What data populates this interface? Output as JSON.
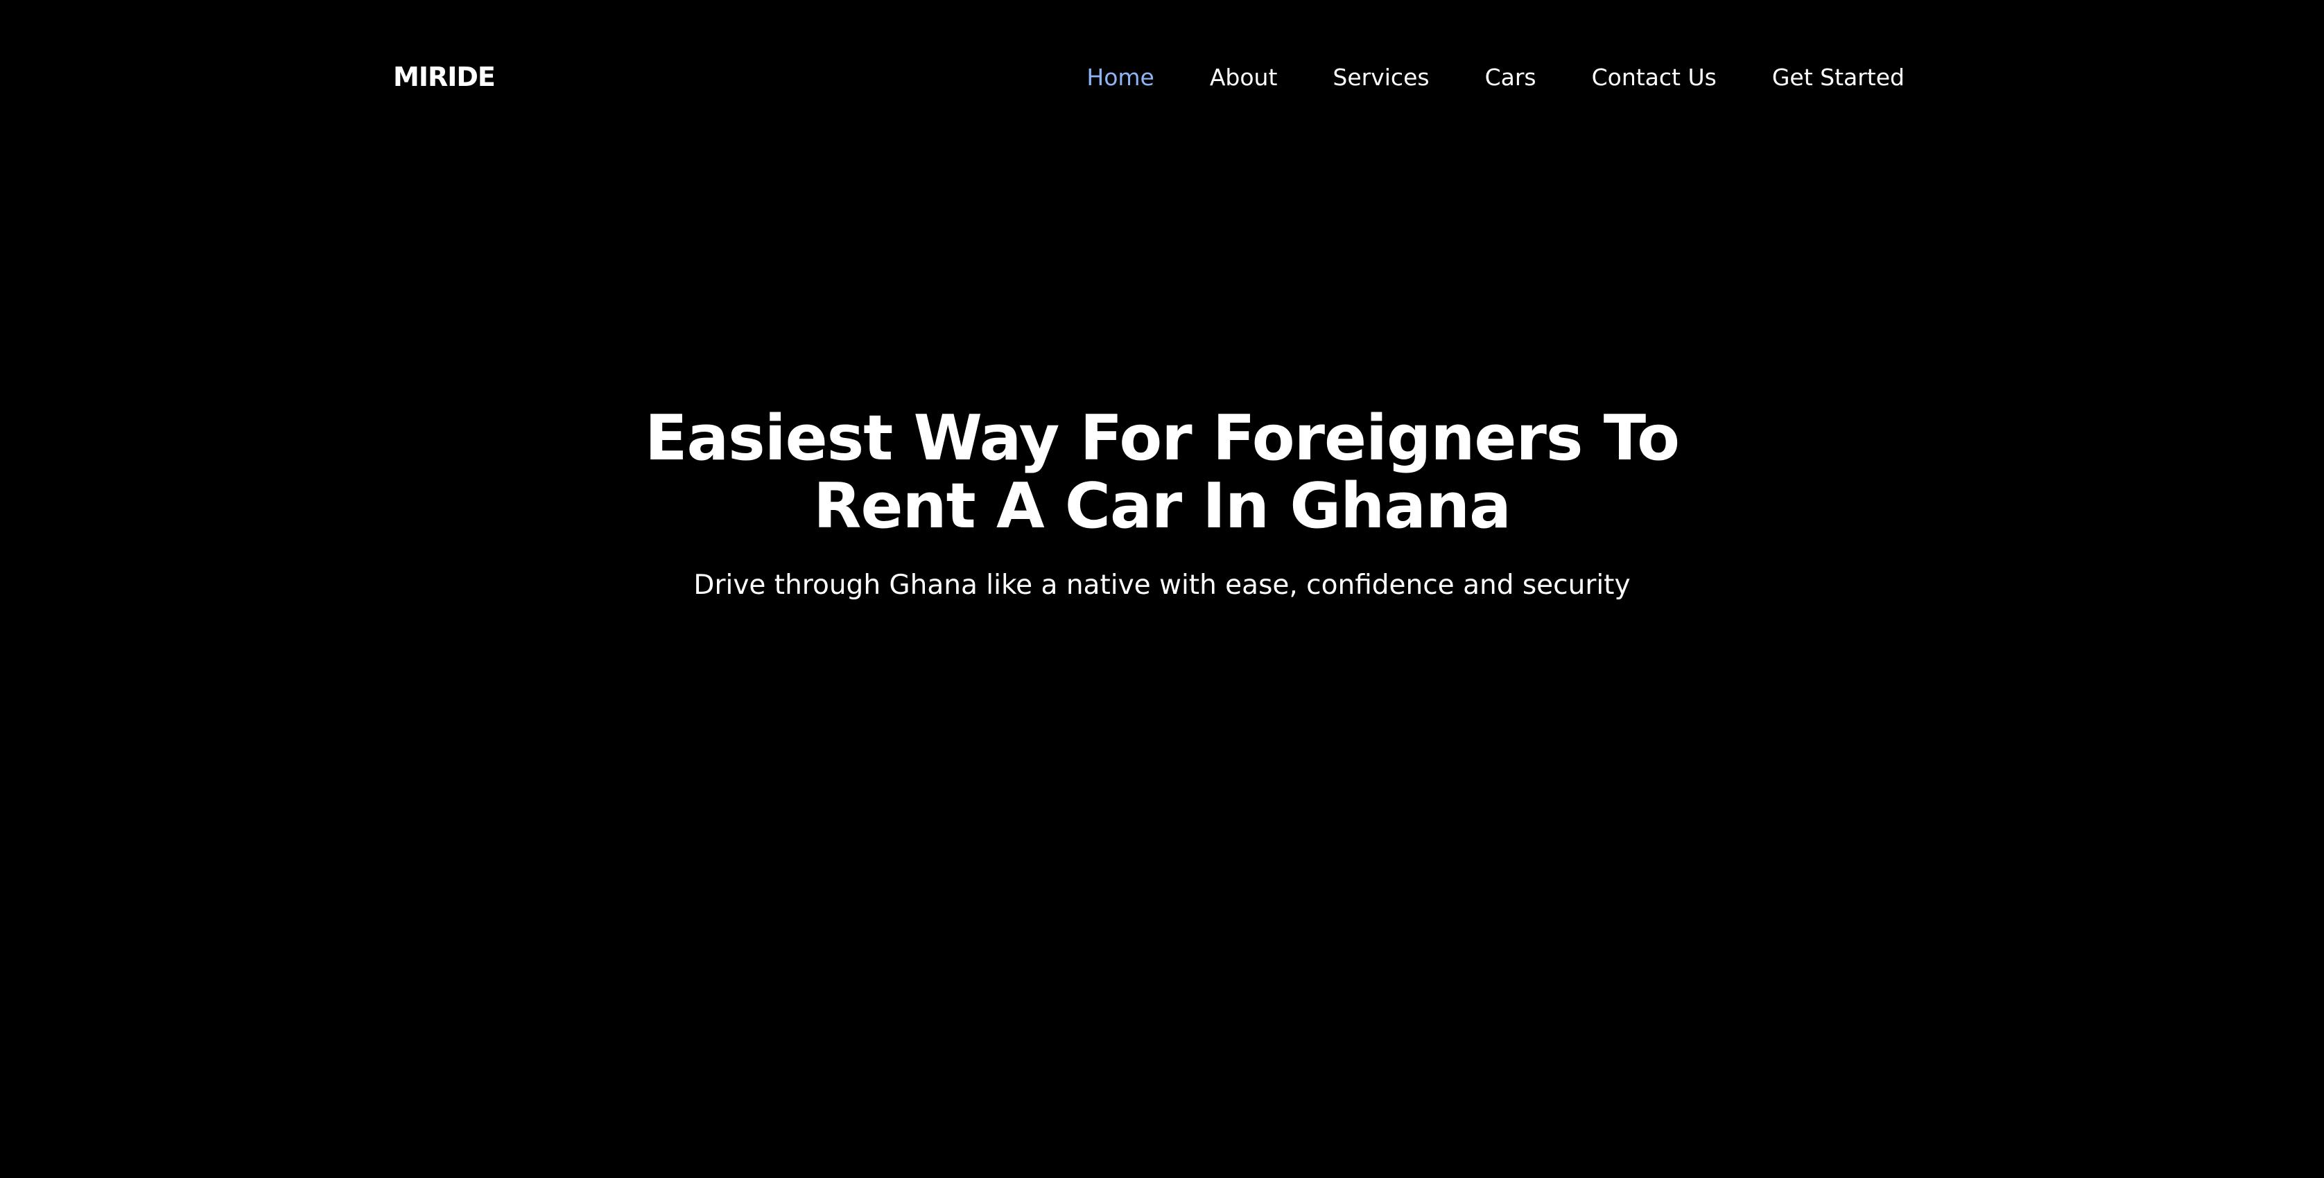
{
  "header": {
    "brand": "MIRIDE",
    "nav": [
      {
        "label": "Home",
        "active": true
      },
      {
        "label": "About",
        "active": false
      },
      {
        "label": "Services",
        "active": false
      },
      {
        "label": "Cars",
        "active": false
      },
      {
        "label": "Contact Us",
        "active": false
      },
      {
        "label": "Get Started",
        "active": false
      }
    ],
    "active_color": "#8fb4f5"
  },
  "hero": {
    "title": "Easiest Way For Foreigners To Rent A Car In Ghana",
    "subtitle": "Drive through Ghana like a native with ease, confidence and security"
  },
  "colors": {
    "background": "#000000",
    "text": "#ffffff"
  }
}
